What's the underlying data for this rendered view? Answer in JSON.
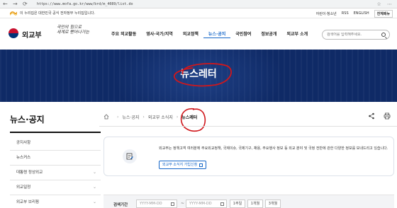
{
  "browser": {
    "url": "https://www.mofa.go.kr/www/brd/m_4089/list.do",
    "back": "←",
    "refresh": "⟳"
  },
  "gov_strip": {
    "notice": "이 누리집은 대한민국 공식 전자정부 누리집입니다.",
    "links": [
      "어린이·청소년",
      "RSS",
      "ENGLISH"
    ],
    "full_menu": "전체메뉴"
  },
  "header": {
    "logo_text": "외교부",
    "slogan_line1": "국민의 힘으로",
    "slogan_line2": "세계로 뻗어나가는",
    "nav": [
      "주요 외교활동",
      "영사·국가/지역",
      "외교정책",
      "뉴스·공지",
      "국민참여",
      "정보공개",
      "외교부 소개"
    ],
    "active_nav_index": 3,
    "search_placeholder": "검색어를 입력해주세요."
  },
  "banner": {
    "title": "뉴스레터"
  },
  "sidebar": {
    "title": "뉴스·공지",
    "items": [
      "공지사항",
      "뉴스커스",
      "대통령 정상외교",
      "외교일정",
      "외교부 브리핑"
    ]
  },
  "breadcrumb": [
    "뉴스·공지",
    "외교부 소식지",
    "뉴스레터"
  ],
  "info": {
    "text": "외교부는 정책고객 여러분께 주요외교정책, 국제이슈, 국제기구, 채용, 주요행사 정보 등 외교 분야 및 국정 전반에 관한 다양한 정보를 보내드리고 있습니다.",
    "subscribe_label": "외교부 소식지 가입신청"
  },
  "search_panel": {
    "label": "검색기간",
    "date_placeholder": "YYYY-MM-DD",
    "range_sep": "~",
    "periods": [
      "1주일",
      "1개월",
      "3개월"
    ]
  },
  "colors": {
    "banner": "#0f2a66",
    "accent": "#1466c8",
    "annotation": "#d0171c"
  }
}
